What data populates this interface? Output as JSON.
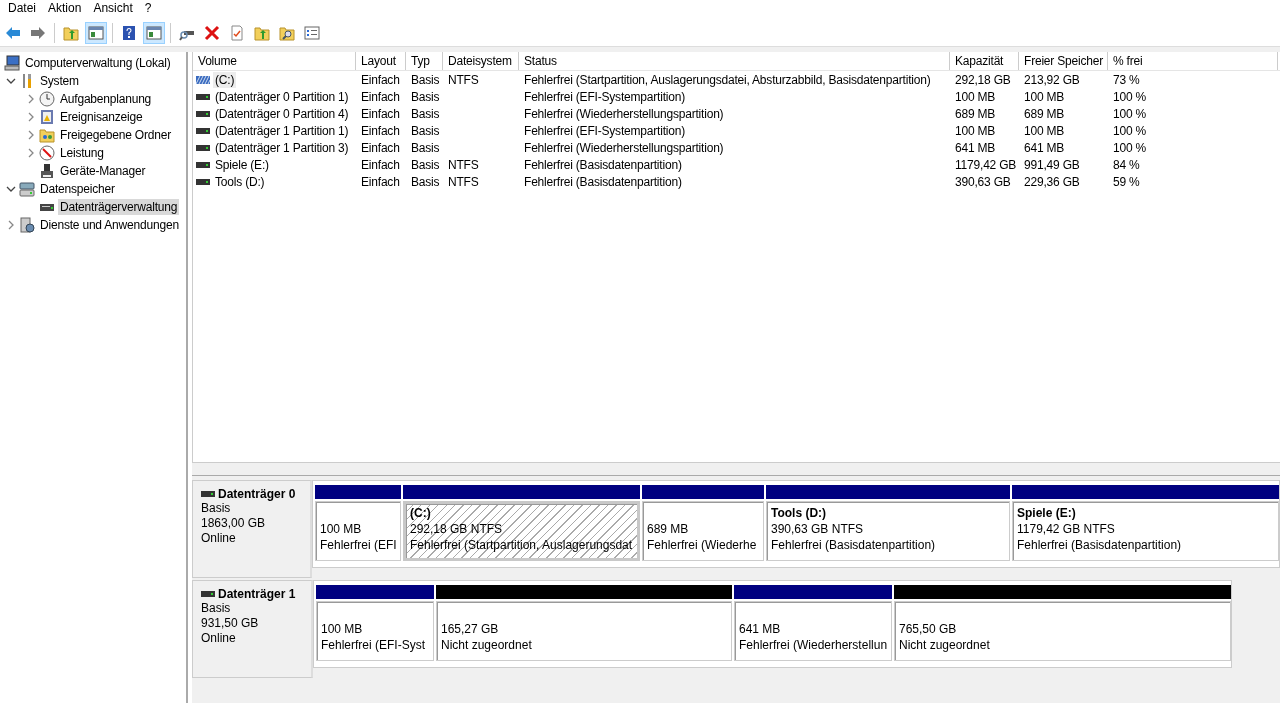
{
  "menu": [
    "Datei",
    "Aktion",
    "Ansicht",
    "?"
  ],
  "toolbar": [
    {
      "kind": "back",
      "pressed": false
    },
    {
      "kind": "forward",
      "pressed": false
    },
    {
      "kind": "separator"
    },
    {
      "kind": "folder",
      "pressed": false
    },
    {
      "kind": "panel",
      "pressed": true
    },
    {
      "kind": "separator"
    },
    {
      "kind": "help",
      "pressed": false
    },
    {
      "kind": "panel",
      "pressed": true
    },
    {
      "kind": "separator"
    },
    {
      "kind": "drive",
      "pressed": false
    },
    {
      "kind": "delete",
      "pressed": false
    },
    {
      "kind": "document",
      "pressed": false
    },
    {
      "kind": "folder",
      "pressed": false
    },
    {
      "kind": "search",
      "pressed": false
    },
    {
      "kind": "list",
      "pressed": false
    }
  ],
  "tree": [
    {
      "label": "Computerverwaltung (Lokal)",
      "kind": "computer",
      "selected": false,
      "children": [
        {
          "label": "System",
          "kind": "tools",
          "expanded": true,
          "selected": false,
          "children": [
            {
              "label": "Aufgabenplanung",
              "kind": "clock",
              "expanded": false,
              "selected": false
            },
            {
              "label": "Ereignisanzeige",
              "kind": "log",
              "expanded": false,
              "selected": false
            },
            {
              "label": "Freigegebene Ordner",
              "kind": "shared",
              "expanded": false,
              "selected": false
            },
            {
              "label": "Leistung",
              "kind": "gauge",
              "expanded": false,
              "selected": false
            },
            {
              "label": "Geräte-Manager",
              "kind": "device",
              "selected": false
            }
          ]
        },
        {
          "label": "Datenspeicher",
          "kind": "storage",
          "expanded": true,
          "selected": false,
          "children": [
            {
              "label": "Datenträgerverwaltung",
              "kind": "disk",
              "selected": true
            }
          ]
        },
        {
          "label": "Dienste und Anwendungen",
          "kind": "services",
          "expanded": false,
          "selected": false
        }
      ]
    }
  ],
  "table": {
    "columns": [
      "Volume",
      "Layout",
      "Typ",
      "Dateisystem",
      "Status",
      "Kapazität",
      "Freier Speicher",
      "% frei"
    ],
    "rows": [
      {
        "kind": "striped",
        "selected": true,
        "cells": [
          "(C:)",
          "Einfach",
          "Basis",
          "NTFS",
          "Fehlerfrei (Startpartition, Auslagerungsdatei, Absturzabbild, Basisdatenpartition)",
          "292,18 GB",
          "213,92 GB",
          "73 %"
        ]
      },
      {
        "kind": "drive",
        "selected": false,
        "cells": [
          "(Datenträger 0 Partition 1)",
          "Einfach",
          "Basis",
          "",
          "Fehlerfrei (EFI-Systempartition)",
          "100 MB",
          "100 MB",
          "100 %"
        ]
      },
      {
        "kind": "drive",
        "selected": false,
        "cells": [
          "(Datenträger 0 Partition 4)",
          "Einfach",
          "Basis",
          "",
          "Fehlerfrei (Wiederherstellungspartition)",
          "689 MB",
          "689 MB",
          "100 %"
        ]
      },
      {
        "kind": "drive",
        "selected": false,
        "cells": [
          "(Datenträger 1 Partition 1)",
          "Einfach",
          "Basis",
          "",
          "Fehlerfrei (EFI-Systempartition)",
          "100 MB",
          "100 MB",
          "100 %"
        ]
      },
      {
        "kind": "drive",
        "selected": false,
        "cells": [
          "(Datenträger 1 Partition 3)",
          "Einfach",
          "Basis",
          "",
          "Fehlerfrei (Wiederherstellungspartition)",
          "641 MB",
          "641 MB",
          "100 %"
        ]
      },
      {
        "kind": "drive",
        "selected": false,
        "cells": [
          "Spiele (E:)",
          "Einfach",
          "Basis",
          "NTFS",
          "Fehlerfrei (Basisdatenpartition)",
          "1179,42 GB",
          "991,49 GB",
          "84 %"
        ]
      },
      {
        "kind": "drive",
        "selected": false,
        "cells": [
          "Tools (D:)",
          "Einfach",
          "Basis",
          "NTFS",
          "Fehlerfrei (Basisdatenpartition)",
          "390,63 GB",
          "229,36 GB",
          "59 %"
        ]
      }
    ]
  },
  "disks": [
    {
      "name": "Datenträger 0",
      "type": "Basis",
      "size": "1863,00 GB",
      "status": "Online",
      "partitions": [
        {
          "kind": "primary",
          "selected": false,
          "size": "100 MB",
          "status": "Fehlerfrei (EFI"
        },
        {
          "kind": "primary",
          "selected": true,
          "name": "(C:)",
          "size": "292,18 GB NTFS",
          "status": "Fehlerfrei (Startpartition, Auslagerungsdat"
        },
        {
          "kind": "primary",
          "selected": false,
          "size": "689 MB",
          "status": "Fehlerfrei (Wiederhe"
        },
        {
          "kind": "primary",
          "selected": false,
          "name": "Tools  (D:)",
          "size": "390,63 GB NTFS",
          "status": "Fehlerfrei (Basisdatenpartition)"
        },
        {
          "kind": "primary",
          "selected": false,
          "name": "Spiele  (E:)",
          "size": "1179,42 GB NTFS",
          "status": "Fehlerfrei (Basisdatenpartition)"
        }
      ]
    },
    {
      "name": "Datenträger 1",
      "type": "Basis",
      "size": "931,50 GB",
      "status": "Online",
      "partitions": [
        {
          "kind": "primary",
          "selected": false,
          "size": "100 MB",
          "status": "Fehlerfrei (EFI-Syst"
        },
        {
          "kind": "unallocated",
          "selected": false,
          "size": "165,27 GB",
          "status": "Nicht zugeordnet"
        },
        {
          "kind": "primary",
          "selected": false,
          "size": "641 MB",
          "status": "Fehlerfrei (Wiederherstellun"
        },
        {
          "kind": "unallocated",
          "selected": false,
          "size": "765,50 GB",
          "status": "Nicht zugeordnet"
        }
      ]
    }
  ]
}
